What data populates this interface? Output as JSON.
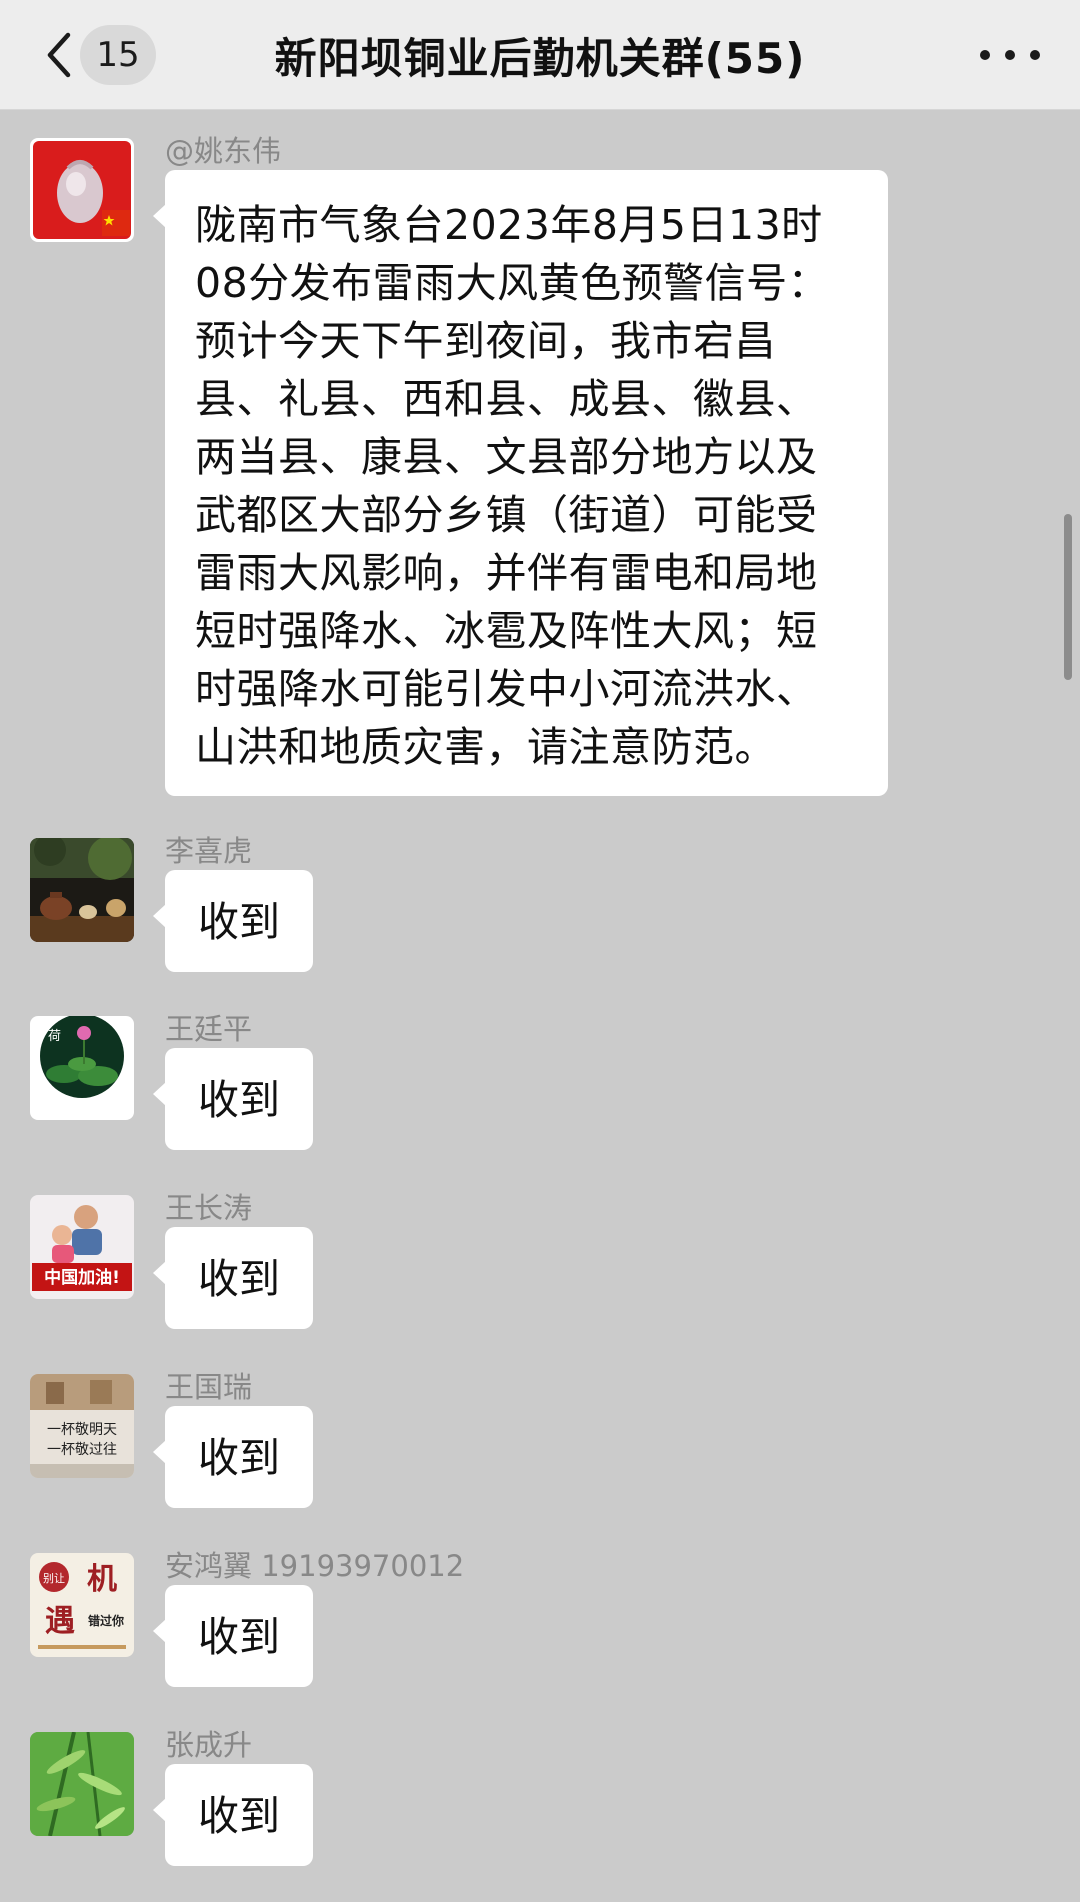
{
  "header": {
    "unread_count": "15",
    "title": "新阳坝铜业后勤机关群(55)",
    "back_icon": "chevron-left-icon",
    "more_icon": "ellipsis-icon"
  },
  "messages": [
    {
      "sender": "@姚东伟",
      "text": "陇南市气象台2023年8月5日13时08分发布雷雨大风黄色预警信号：预计今天下午到夜间，我市宕昌县、礼县、西和县、成县、徽县、两当县、康县、文县部分地方以及武都区大部分乡镇（街道）可能受雷雨大风影响，并伴有雷电和局地短时强降水、冰雹及阵性大风；短时强降水可能引发中小河流洪水、山洪和地质灾害，请注意防范。"
    },
    {
      "sender": "李喜虎",
      "text": "收到"
    },
    {
      "sender": "王廷平",
      "text": "收到"
    },
    {
      "sender": "王长涛",
      "text": "收到"
    },
    {
      "sender": "王国瑞",
      "text": "收到"
    },
    {
      "sender": "安鸿翼 19193970012",
      "text": "收到"
    },
    {
      "sender": "张成升",
      "text": "收到"
    }
  ],
  "avatars": {
    "a3_caption": "中国加油!",
    "a4_caption_top": "一杯敬明天",
    "a4_caption_bottom": "一杯敬过往",
    "a5_big1": "机",
    "a5_big2": "遇",
    "a5_small1": "别让",
    "a5_small2": "错过你",
    "a2_mark": "荷"
  },
  "colors": {
    "background": "#cbcbcb",
    "navbar": "#ededed",
    "bubble": "#ffffff"
  }
}
